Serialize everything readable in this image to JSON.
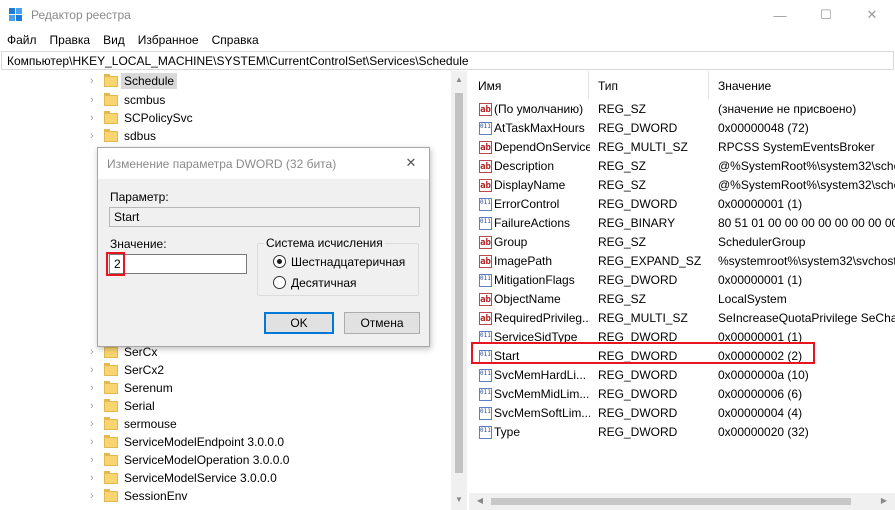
{
  "window": {
    "title": "Редактор реестра",
    "controls": {
      "minimize": "—",
      "maximize": "☐",
      "close": "✕"
    }
  },
  "menu": [
    "Файл",
    "Правка",
    "Вид",
    "Избранное",
    "Справка"
  ],
  "address": "Компьютер\\HKEY_LOCAL_MACHINE\\SYSTEM\\CurrentControlSet\\Services\\Schedule",
  "tree": {
    "items": [
      {
        "label": "Schedule",
        "selected": true
      },
      {
        "label": "scmbus"
      },
      {
        "label": "SCPolicySvc"
      },
      {
        "label": "sdbus"
      },
      {
        "label": "SerCx"
      },
      {
        "label": "SerCx2"
      },
      {
        "label": "Serenum"
      },
      {
        "label": "Serial"
      },
      {
        "label": "sermouse"
      },
      {
        "label": "ServiceModelEndpoint 3.0.0.0"
      },
      {
        "label": "ServiceModelOperation 3.0.0.0"
      },
      {
        "label": "ServiceModelService 3.0.0.0"
      },
      {
        "label": "SessionEnv"
      }
    ]
  },
  "values": {
    "columns": {
      "name": "Имя",
      "type": "Тип",
      "data": "Значение"
    },
    "rows": [
      {
        "name": "(По умолчанию)",
        "type": "REG_SZ",
        "data": "(значение не присвоено)",
        "kind": "string"
      },
      {
        "name": "AtTaskMaxHours",
        "type": "REG_DWORD",
        "data": "0x00000048 (72)",
        "kind": "binary"
      },
      {
        "name": "DependOnService",
        "type": "REG_MULTI_SZ",
        "data": "RPCSS SystemEventsBroker",
        "kind": "string"
      },
      {
        "name": "Description",
        "type": "REG_SZ",
        "data": "@%SystemRoot%\\system32\\sche",
        "kind": "string"
      },
      {
        "name": "DisplayName",
        "type": "REG_SZ",
        "data": "@%SystemRoot%\\system32\\sche",
        "kind": "string"
      },
      {
        "name": "ErrorControl",
        "type": "REG_DWORD",
        "data": "0x00000001 (1)",
        "kind": "binary"
      },
      {
        "name": "FailureActions",
        "type": "REG_BINARY",
        "data": "80 51 01 00 00 00 00 00 00 00 00 00",
        "kind": "binary"
      },
      {
        "name": "Group",
        "type": "REG_SZ",
        "data": "SchedulerGroup",
        "kind": "string"
      },
      {
        "name": "ImagePath",
        "type": "REG_EXPAND_SZ",
        "data": "%systemroot%\\system32\\svchost",
        "kind": "string"
      },
      {
        "name": "MitigationFlags",
        "type": "REG_DWORD",
        "data": "0x00000001 (1)",
        "kind": "binary"
      },
      {
        "name": "ObjectName",
        "type": "REG_SZ",
        "data": "LocalSystem",
        "kind": "string"
      },
      {
        "name": "RequiredPrivileg...",
        "type": "REG_MULTI_SZ",
        "data": "SeIncreaseQuotaPrivilege SeChan",
        "kind": "string"
      },
      {
        "name": "ServiceSidType",
        "type": "REG_DWORD",
        "data": "0x00000001 (1)",
        "kind": "binary"
      },
      {
        "name": "Start",
        "type": "REG_DWORD",
        "data": "0x00000002 (2)",
        "kind": "binary",
        "highlighted": true
      },
      {
        "name": "SvcMemHardLi...",
        "type": "REG_DWORD",
        "data": "0x0000000a (10)",
        "kind": "binary"
      },
      {
        "name": "SvcMemMidLim...",
        "type": "REG_DWORD",
        "data": "0x00000006 (6)",
        "kind": "binary"
      },
      {
        "name": "SvcMemSoftLim...",
        "type": "REG_DWORD",
        "data": "0x00000004 (4)",
        "kind": "binary"
      },
      {
        "name": "Type",
        "type": "REG_DWORD",
        "data": "0x00000020 (32)",
        "kind": "binary"
      }
    ]
  },
  "icons": {
    "string": "ab",
    "binary": "011 110"
  },
  "dialog": {
    "title": "Изменение параметра DWORD (32 бита)",
    "close": "✕",
    "param_label": "Параметр:",
    "param_value": "Start",
    "value_label": "Значение:",
    "value": "2",
    "base_group": "Система исчисления",
    "base_options": [
      {
        "label": "Шестнадцатеричная",
        "checked": true
      },
      {
        "label": "Десятичная",
        "checked": false
      }
    ],
    "ok": "OK",
    "cancel": "Отмена"
  },
  "colors": {
    "highlight": "#e8141f",
    "folder": "#f9d572",
    "accent": "#0078d7"
  }
}
